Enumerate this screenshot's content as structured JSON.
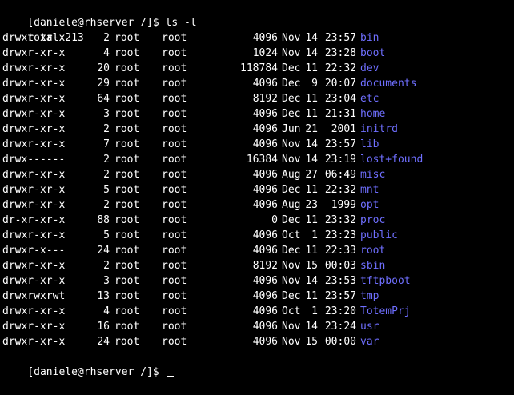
{
  "colors": {
    "background": "#000000",
    "foreground": "#ffffff",
    "directory": "#6f6fff",
    "cursor": "#ffffff"
  },
  "prompt_top": {
    "text": "[daniele@rhserver /]$ ",
    "command": "ls -l"
  },
  "total": "total 213",
  "entries": [
    {
      "perms": "drwxr-xr-x",
      "links": "2",
      "owner": "root",
      "group": "root",
      "size": "4096",
      "month": "Nov",
      "day": "14",
      "time": "23:57",
      "name": "bin"
    },
    {
      "perms": "drwxr-xr-x",
      "links": "4",
      "owner": "root",
      "group": "root",
      "size": "1024",
      "month": "Nov",
      "day": "14",
      "time": "23:28",
      "name": "boot"
    },
    {
      "perms": "drwxr-xr-x",
      "links": "20",
      "owner": "root",
      "group": "root",
      "size": "118784",
      "month": "Dec",
      "day": "11",
      "time": "22:32",
      "name": "dev"
    },
    {
      "perms": "drwxr-xr-x",
      "links": "29",
      "owner": "root",
      "group": "root",
      "size": "4096",
      "month": "Dec",
      "day": "9",
      "time": "20:07",
      "name": "documents"
    },
    {
      "perms": "drwxr-xr-x",
      "links": "64",
      "owner": "root",
      "group": "root",
      "size": "8192",
      "month": "Dec",
      "day": "11",
      "time": "23:04",
      "name": "etc"
    },
    {
      "perms": "drwxr-xr-x",
      "links": "3",
      "owner": "root",
      "group": "root",
      "size": "4096",
      "month": "Dec",
      "day": "11",
      "time": "21:31",
      "name": "home"
    },
    {
      "perms": "drwxr-xr-x",
      "links": "2",
      "owner": "root",
      "group": "root",
      "size": "4096",
      "month": "Jun",
      "day": "21",
      "time": "2001",
      "name": "initrd"
    },
    {
      "perms": "drwxr-xr-x",
      "links": "7",
      "owner": "root",
      "group": "root",
      "size": "4096",
      "month": "Nov",
      "day": "14",
      "time": "23:57",
      "name": "lib"
    },
    {
      "perms": "drwx------",
      "links": "2",
      "owner": "root",
      "group": "root",
      "size": "16384",
      "month": "Nov",
      "day": "14",
      "time": "23:19",
      "name": "lost+found"
    },
    {
      "perms": "drwxr-xr-x",
      "links": "2",
      "owner": "root",
      "group": "root",
      "size": "4096",
      "month": "Aug",
      "day": "27",
      "time": "06:49",
      "name": "misc"
    },
    {
      "perms": "drwxr-xr-x",
      "links": "5",
      "owner": "root",
      "group": "root",
      "size": "4096",
      "month": "Dec",
      "day": "11",
      "time": "22:32",
      "name": "mnt"
    },
    {
      "perms": "drwxr-xr-x",
      "links": "2",
      "owner": "root",
      "group": "root",
      "size": "4096",
      "month": "Aug",
      "day": "23",
      "time": "1999",
      "name": "opt"
    },
    {
      "perms": "dr-xr-xr-x",
      "links": "88",
      "owner": "root",
      "group": "root",
      "size": "0",
      "month": "Dec",
      "day": "11",
      "time": "23:32",
      "name": "proc"
    },
    {
      "perms": "drwxr-xr-x",
      "links": "5",
      "owner": "root",
      "group": "root",
      "size": "4096",
      "month": "Oct",
      "day": "1",
      "time": "23:23",
      "name": "public"
    },
    {
      "perms": "drwxr-x---",
      "links": "24",
      "owner": "root",
      "group": "root",
      "size": "4096",
      "month": "Dec",
      "day": "11",
      "time": "22:33",
      "name": "root"
    },
    {
      "perms": "drwxr-xr-x",
      "links": "2",
      "owner": "root",
      "group": "root",
      "size": "8192",
      "month": "Nov",
      "day": "15",
      "time": "00:03",
      "name": "sbin"
    },
    {
      "perms": "drwxr-xr-x",
      "links": "3",
      "owner": "root",
      "group": "root",
      "size": "4096",
      "month": "Nov",
      "day": "14",
      "time": "23:53",
      "name": "tftpboot"
    },
    {
      "perms": "drwxrwxrwt",
      "links": "13",
      "owner": "root",
      "group": "root",
      "size": "4096",
      "month": "Dec",
      "day": "11",
      "time": "23:57",
      "name": "tmp"
    },
    {
      "perms": "drwxr-xr-x",
      "links": "4",
      "owner": "root",
      "group": "root",
      "size": "4096",
      "month": "Oct",
      "day": "1",
      "time": "23:20",
      "name": "TotemPrj"
    },
    {
      "perms": "drwxr-xr-x",
      "links": "16",
      "owner": "root",
      "group": "root",
      "size": "4096",
      "month": "Nov",
      "day": "14",
      "time": "23:24",
      "name": "usr"
    },
    {
      "perms": "drwxr-xr-x",
      "links": "24",
      "owner": "root",
      "group": "root",
      "size": "4096",
      "month": "Nov",
      "day": "15",
      "time": "00:00",
      "name": "var"
    }
  ],
  "prompt_bottom": {
    "text": "[daniele@rhserver /]$ "
  }
}
